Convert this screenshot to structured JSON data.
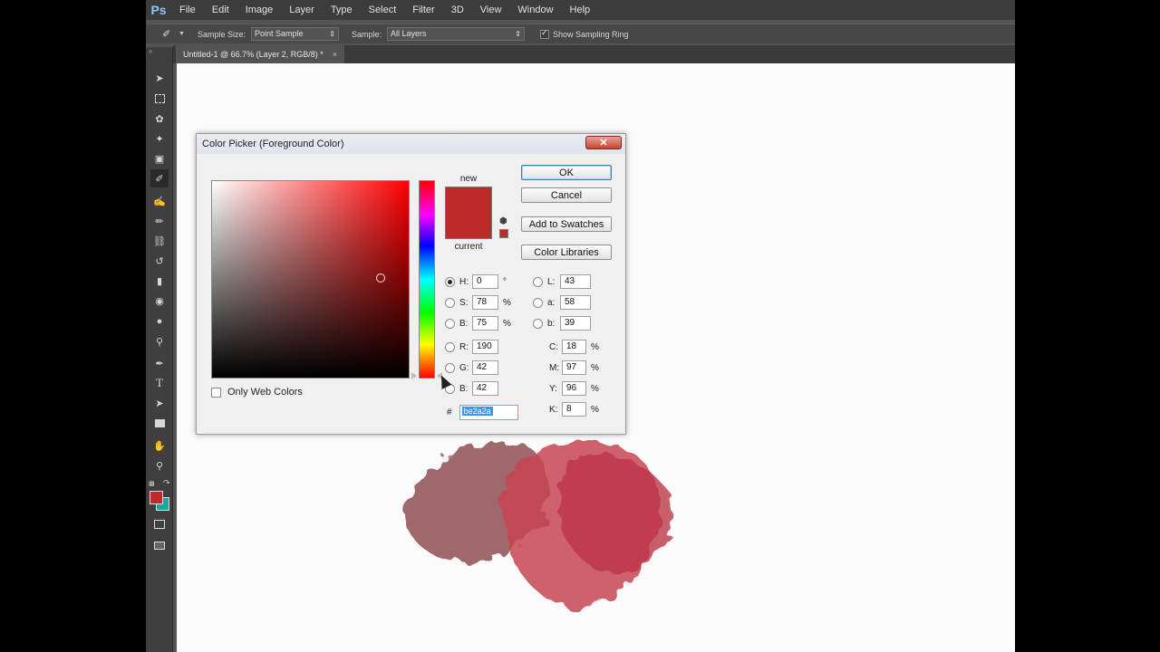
{
  "app": {
    "logo": "Ps",
    "menu": [
      "File",
      "Edit",
      "Image",
      "Layer",
      "Type",
      "Select",
      "Filter",
      "3D",
      "View",
      "Window",
      "Help"
    ]
  },
  "options_bar": {
    "tool_icon": "eyedropper-icon",
    "sample_size_label": "Sample Size:",
    "sample_size_value": "Point Sample",
    "sample_label": "Sample:",
    "sample_value": "All Layers",
    "show_ring_label": "Show Sampling Ring",
    "show_ring_checked": true
  },
  "document_tab": {
    "title": "Untitled-1 @ 66.7% (Layer 2, RGB/8) *",
    "close": "×"
  },
  "toolbox": {
    "tools": [
      "move-icon",
      "marquee-icon",
      "lasso-icon",
      "magic-wand-icon",
      "crop-icon",
      "eyedropper-icon",
      "healing-brush-icon",
      "brush-icon",
      "clone-stamp-icon",
      "history-brush-icon",
      "eraser-icon",
      "paint-bucket-icon",
      "blur-icon",
      "dodge-icon",
      "pen-icon",
      "type-icon",
      "path-selection-icon",
      "rectangle-icon",
      "hand-icon",
      "zoom-icon"
    ],
    "active_tool": "eyedropper-icon",
    "foreground_color": "#be2a2a",
    "background_color": "#1aa8a0"
  },
  "dialog": {
    "title": "Color Picker (Foreground Color)",
    "close": "✕",
    "new_label": "new",
    "current_label": "current",
    "new_color": "#be2a2a",
    "current_color": "#be2a2a",
    "only_web_colors": "Only Web Colors",
    "buttons": {
      "ok": "OK",
      "cancel": "Cancel",
      "add_swatches": "Add to Swatches",
      "color_libraries": "Color Libraries"
    },
    "hsb": {
      "h": {
        "label": "H:",
        "value": "0",
        "unit": "°",
        "selected": true
      },
      "s": {
        "label": "S:",
        "value": "78",
        "unit": "%"
      },
      "b": {
        "label": "B:",
        "value": "75",
        "unit": "%"
      }
    },
    "rgb": {
      "r": {
        "label": "R:",
        "value": "190"
      },
      "g": {
        "label": "G:",
        "value": "42"
      },
      "b": {
        "label": "B:",
        "value": "42"
      }
    },
    "lab": {
      "l": {
        "label": "L:",
        "value": "43"
      },
      "a": {
        "label": "a:",
        "value": "58"
      },
      "b": {
        "label": "b:",
        "value": "39"
      }
    },
    "cmyk": {
      "c": {
        "label": "C:",
        "value": "18",
        "unit": "%"
      },
      "m": {
        "label": "M:",
        "value": "97",
        "unit": "%"
      },
      "y": {
        "label": "Y:",
        "value": "96",
        "unit": "%"
      },
      "k": {
        "label": "K:",
        "value": "8",
        "unit": "%"
      }
    },
    "hex_label": "#",
    "hex_value": "be2a2a"
  },
  "canvas": {
    "stroke_colors": [
      "#8b4a4f",
      "#c23644",
      "#b8243a"
    ]
  }
}
